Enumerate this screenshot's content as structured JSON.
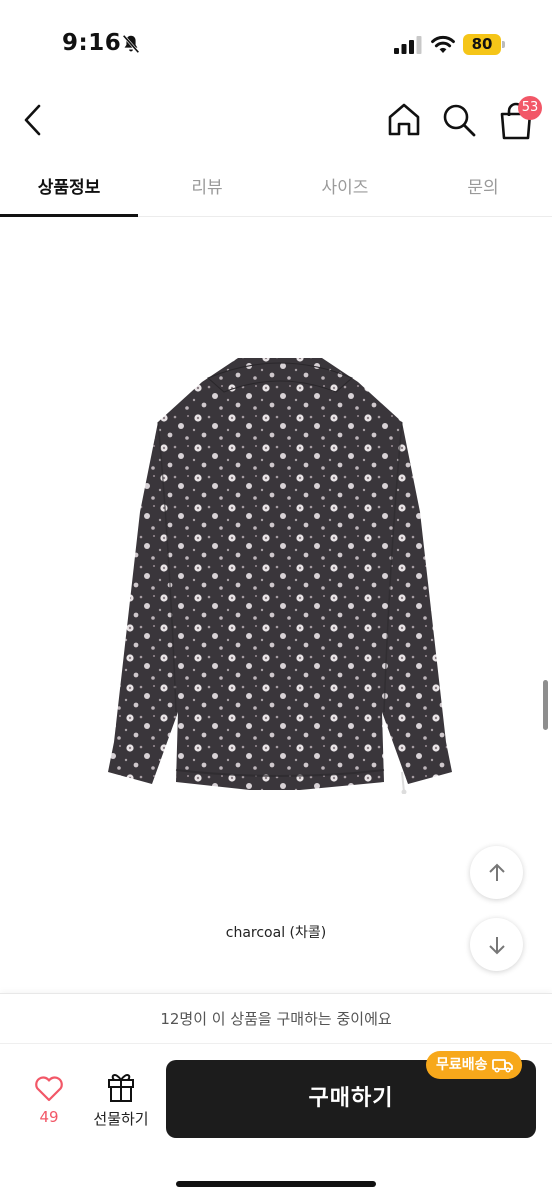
{
  "status_bar": {
    "time": "9:16",
    "battery": "80",
    "icons": [
      "bell-slash-icon",
      "signal-icon",
      "wifi-icon",
      "battery-icon"
    ]
  },
  "header": {
    "icons": [
      "back-icon",
      "home-icon",
      "search-icon",
      "cart-icon"
    ],
    "cart_count": "53"
  },
  "tabs": [
    {
      "label": "상품정보",
      "active": true
    },
    {
      "label": "리뷰",
      "active": false
    },
    {
      "label": "사이즈",
      "active": false
    },
    {
      "label": "문의",
      "active": false
    }
  ],
  "product": {
    "caption": "charcoal (차콜)"
  },
  "floating": {
    "icons": [
      "arrow-up-icon",
      "arrow-down-icon"
    ]
  },
  "bottom_bar": {
    "notice": "12명이 이 상품을 구매하는 중이에요",
    "like_count": "49",
    "gift_label": "선물하기",
    "buy_label": "구매하기",
    "shipping_badge": "무료배송"
  },
  "colors": {
    "accent": "#f25767",
    "badge": "#f7a81b",
    "buy_button": "#1c1c1c"
  }
}
